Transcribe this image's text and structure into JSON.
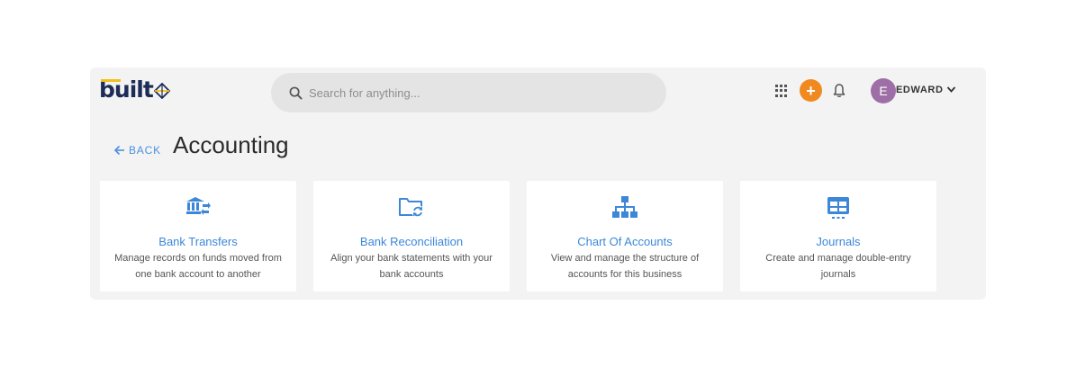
{
  "header": {
    "logo_text": "built",
    "search": {
      "placeholder": "Search for anything..."
    },
    "add_label": "+",
    "user": {
      "initial": "E",
      "name": "EDWARD"
    }
  },
  "page": {
    "back_label": "BACK",
    "title": "Accounting"
  },
  "cards": [
    {
      "title": "Bank Transfers",
      "description": "Manage records on funds moved from one bank account to another",
      "icon": "bank-transfer-icon"
    },
    {
      "title": "Bank Reconciliation",
      "description": "Align your bank statements with your bank accounts",
      "icon": "folder-sync-icon"
    },
    {
      "title": "Chart Of Accounts",
      "description": "View and manage the structure of accounts for this business",
      "icon": "sitemap-icon"
    },
    {
      "title": "Journals",
      "description": "Create and manage double-entry journals",
      "icon": "journal-table-icon"
    }
  ],
  "colors": {
    "accent": "#3d87d8",
    "brand_navy": "#1d2b57",
    "brand_yellow": "#f2c01a",
    "add_button": "#f0891f",
    "avatar": "#9e6fa6"
  }
}
